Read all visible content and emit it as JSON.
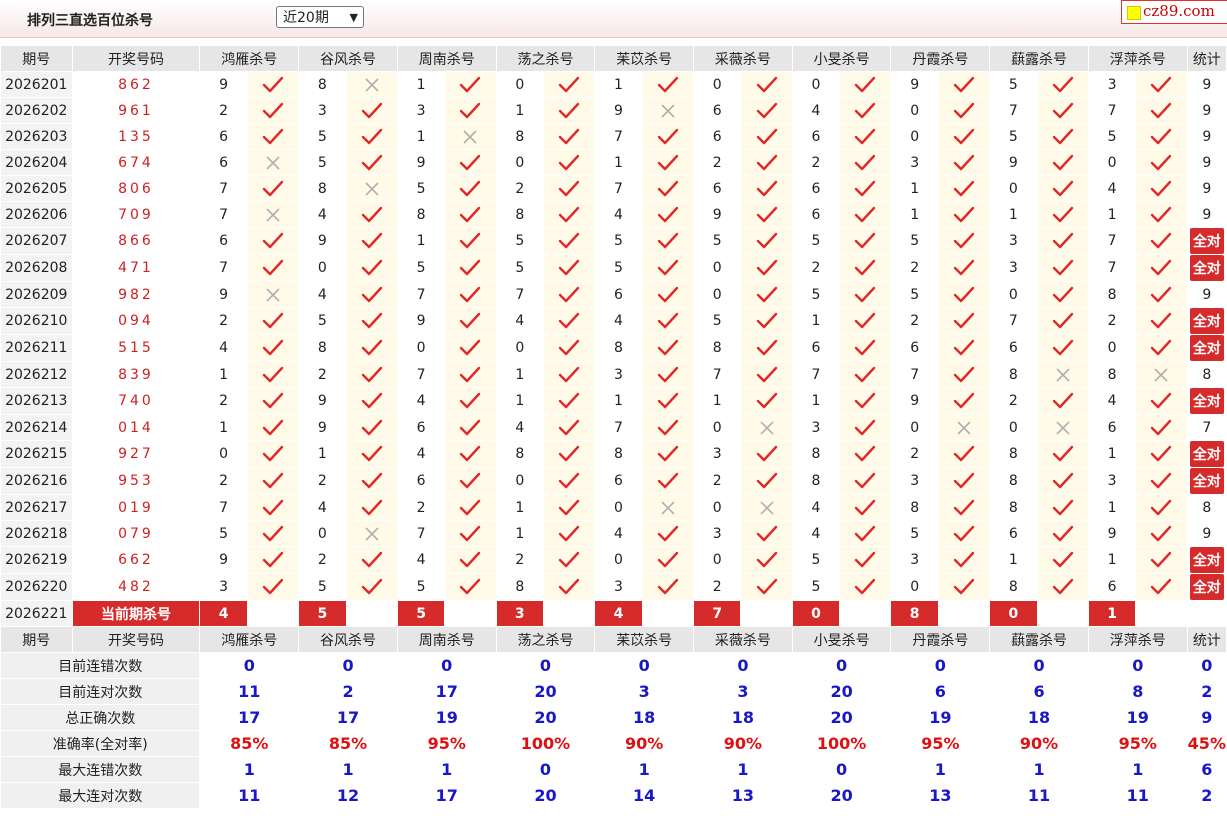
{
  "header": {
    "title": "排列三直选百位杀号",
    "period_select": "近20期",
    "brand": "cz89.com"
  },
  "columns": {
    "issue": "期号",
    "draw": "开奖号码",
    "experts": [
      "鸿雁杀号",
      "谷风杀号",
      "周南杀号",
      "荡之杀号",
      "苿苡杀号",
      "采薇杀号",
      "小旻杀号",
      "丹霞杀号",
      "蕻露杀号",
      "浮萍杀号"
    ],
    "stat": "统计"
  },
  "rows": [
    {
      "issue": "2026201",
      "draw": "862",
      "kills": [
        9,
        8,
        1,
        0,
        1,
        0,
        0,
        9,
        5,
        3
      ],
      "ok": [
        1,
        0,
        1,
        1,
        1,
        1,
        1,
        1,
        1,
        1
      ],
      "stat": "9"
    },
    {
      "issue": "2026202",
      "draw": "961",
      "kills": [
        2,
        3,
        3,
        1,
        9,
        6,
        4,
        0,
        7,
        7
      ],
      "ok": [
        1,
        1,
        1,
        1,
        0,
        1,
        1,
        1,
        1,
        1
      ],
      "stat": "9"
    },
    {
      "issue": "2026203",
      "draw": "135",
      "kills": [
        6,
        5,
        1,
        8,
        7,
        6,
        6,
        0,
        5,
        5
      ],
      "ok": [
        1,
        1,
        0,
        1,
        1,
        1,
        1,
        1,
        1,
        1
      ],
      "stat": "9"
    },
    {
      "issue": "2026204",
      "draw": "674",
      "kills": [
        6,
        5,
        9,
        0,
        1,
        2,
        2,
        3,
        9,
        0
      ],
      "ok": [
        0,
        1,
        1,
        1,
        1,
        1,
        1,
        1,
        1,
        1
      ],
      "stat": "9"
    },
    {
      "issue": "2026205",
      "draw": "806",
      "kills": [
        7,
        8,
        5,
        2,
        7,
        6,
        6,
        1,
        0,
        4
      ],
      "ok": [
        1,
        0,
        1,
        1,
        1,
        1,
        1,
        1,
        1,
        1
      ],
      "stat": "9"
    },
    {
      "issue": "2026206",
      "draw": "709",
      "kills": [
        7,
        4,
        8,
        8,
        4,
        9,
        6,
        1,
        1,
        1
      ],
      "ok": [
        0,
        1,
        1,
        1,
        1,
        1,
        1,
        1,
        1,
        1
      ],
      "stat": "9"
    },
    {
      "issue": "2026207",
      "draw": "866",
      "kills": [
        6,
        9,
        1,
        5,
        5,
        5,
        5,
        5,
        3,
        7
      ],
      "ok": [
        1,
        1,
        1,
        1,
        1,
        1,
        1,
        1,
        1,
        1
      ],
      "stat": "全对"
    },
    {
      "issue": "2026208",
      "draw": "471",
      "kills": [
        7,
        0,
        5,
        5,
        5,
        0,
        2,
        2,
        3,
        7
      ],
      "ok": [
        1,
        1,
        1,
        1,
        1,
        1,
        1,
        1,
        1,
        1
      ],
      "stat": "全对"
    },
    {
      "issue": "2026209",
      "draw": "982",
      "kills": [
        9,
        4,
        7,
        7,
        6,
        0,
        5,
        5,
        0,
        8
      ],
      "ok": [
        0,
        1,
        1,
        1,
        1,
        1,
        1,
        1,
        1,
        1
      ],
      "stat": "9"
    },
    {
      "issue": "2026210",
      "draw": "094",
      "kills": [
        2,
        5,
        9,
        4,
        4,
        5,
        1,
        2,
        7,
        2
      ],
      "ok": [
        1,
        1,
        1,
        1,
        1,
        1,
        1,
        1,
        1,
        1
      ],
      "stat": "全对"
    },
    {
      "issue": "2026211",
      "draw": "515",
      "kills": [
        4,
        8,
        0,
        0,
        8,
        8,
        6,
        6,
        6,
        0
      ],
      "ok": [
        1,
        1,
        1,
        1,
        1,
        1,
        1,
        1,
        1,
        1
      ],
      "stat": "全对"
    },
    {
      "issue": "2026212",
      "draw": "839",
      "kills": [
        1,
        2,
        7,
        1,
        3,
        7,
        7,
        7,
        8,
        8
      ],
      "ok": [
        1,
        1,
        1,
        1,
        1,
        1,
        1,
        1,
        0,
        0
      ],
      "stat": "8"
    },
    {
      "issue": "2026213",
      "draw": "740",
      "kills": [
        2,
        9,
        4,
        1,
        1,
        1,
        1,
        9,
        2,
        4
      ],
      "ok": [
        1,
        1,
        1,
        1,
        1,
        1,
        1,
        1,
        1,
        1
      ],
      "stat": "全对"
    },
    {
      "issue": "2026214",
      "draw": "014",
      "kills": [
        1,
        9,
        6,
        4,
        7,
        0,
        3,
        0,
        0,
        6
      ],
      "ok": [
        1,
        1,
        1,
        1,
        1,
        0,
        1,
        0,
        0,
        1
      ],
      "stat": "7"
    },
    {
      "issue": "2026215",
      "draw": "927",
      "kills": [
        0,
        1,
        4,
        8,
        8,
        3,
        8,
        2,
        8,
        1
      ],
      "ok": [
        1,
        1,
        1,
        1,
        1,
        1,
        1,
        1,
        1,
        1
      ],
      "stat": "全对"
    },
    {
      "issue": "2026216",
      "draw": "953",
      "kills": [
        2,
        2,
        6,
        0,
        6,
        2,
        8,
        3,
        8,
        3
      ],
      "ok": [
        1,
        1,
        1,
        1,
        1,
        1,
        1,
        1,
        1,
        1
      ],
      "stat": "全对"
    },
    {
      "issue": "2026217",
      "draw": "019",
      "kills": [
        7,
        4,
        2,
        1,
        0,
        0,
        4,
        8,
        8,
        1
      ],
      "ok": [
        1,
        1,
        1,
        1,
        0,
        0,
        1,
        1,
        1,
        1
      ],
      "stat": "8"
    },
    {
      "issue": "2026218",
      "draw": "079",
      "kills": [
        5,
        0,
        7,
        1,
        4,
        3,
        4,
        5,
        6,
        9
      ],
      "ok": [
        1,
        0,
        1,
        1,
        1,
        1,
        1,
        1,
        1,
        1
      ],
      "stat": "9"
    },
    {
      "issue": "2026219",
      "draw": "662",
      "kills": [
        9,
        2,
        4,
        2,
        0,
        0,
        5,
        3,
        1,
        1
      ],
      "ok": [
        1,
        1,
        1,
        1,
        1,
        1,
        1,
        1,
        1,
        1
      ],
      "stat": "全对"
    },
    {
      "issue": "2026220",
      "draw": "482",
      "kills": [
        3,
        5,
        5,
        8,
        3,
        2,
        5,
        0,
        8,
        6
      ],
      "ok": [
        1,
        1,
        1,
        1,
        1,
        1,
        1,
        1,
        1,
        1
      ],
      "stat": "全对"
    }
  ],
  "current": {
    "issue": "2026221",
    "label": "当前期杀号",
    "kills": [
      "4",
      "5",
      "5",
      "3",
      "4",
      "7",
      "0",
      "8",
      "0",
      "1"
    ]
  },
  "summary": [
    {
      "label": "目前连错次数",
      "values": [
        "0",
        "0",
        "0",
        "0",
        "0",
        "0",
        "0",
        "0",
        "0",
        "0"
      ],
      "stat": "0",
      "red": false
    },
    {
      "label": "目前连对次数",
      "values": [
        "11",
        "2",
        "17",
        "20",
        "3",
        "3",
        "20",
        "6",
        "6",
        "8"
      ],
      "stat": "2",
      "red": false
    },
    {
      "label": "总正确次数",
      "values": [
        "17",
        "17",
        "19",
        "20",
        "18",
        "18",
        "20",
        "19",
        "18",
        "19"
      ],
      "stat": "9",
      "red": false
    },
    {
      "label": "准确率(全对率)",
      "values": [
        "85%",
        "85%",
        "95%",
        "100%",
        "90%",
        "90%",
        "100%",
        "95%",
        "90%",
        "95%"
      ],
      "stat": "45%",
      "red": true
    },
    {
      "label": "最大连错次数",
      "values": [
        "1",
        "1",
        "1",
        "0",
        "1",
        "1",
        "0",
        "1",
        "1",
        "1"
      ],
      "stat": "6",
      "red": false
    },
    {
      "label": "最大连对次数",
      "values": [
        "11",
        "12",
        "17",
        "20",
        "14",
        "13",
        "20",
        "13",
        "11",
        "11"
      ],
      "stat": "2",
      "red": false
    }
  ],
  "icons": {
    "correct": "check-icon",
    "wrong": "cross-icon"
  },
  "colors": {
    "accent": "#d52b2b",
    "check": "#e02828",
    "cross": "#b0b0b0",
    "summary_blue": "#1818c8"
  }
}
